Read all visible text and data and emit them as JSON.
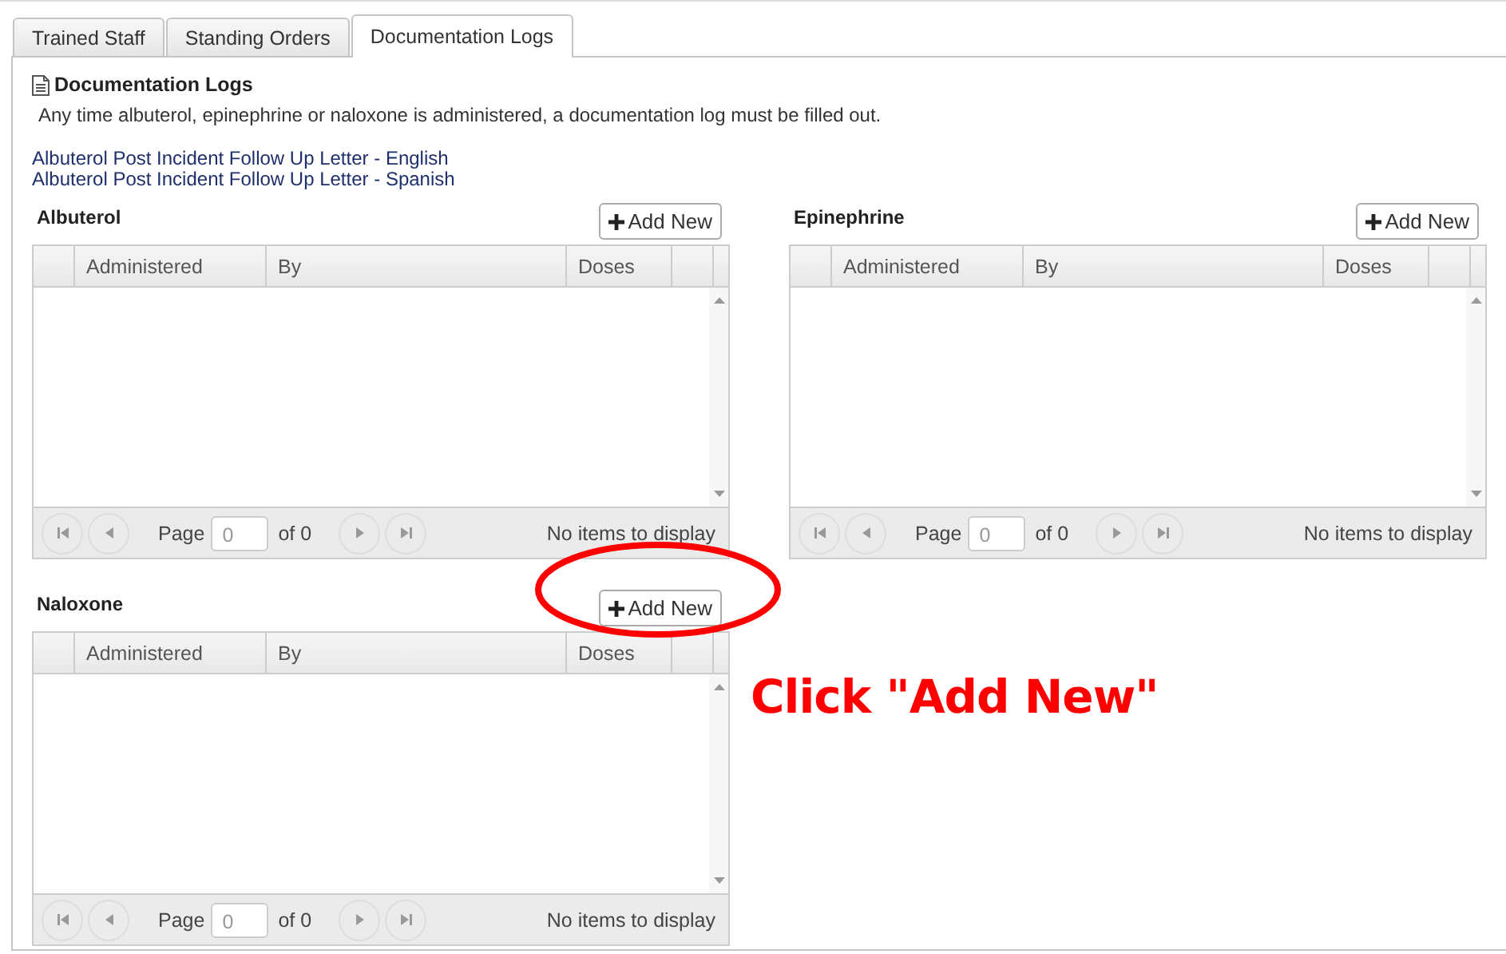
{
  "tabs": [
    {
      "label": "Trained Staff",
      "selected": false
    },
    {
      "label": "Standing Orders",
      "selected": false
    },
    {
      "label": "Documentation Logs",
      "selected": true
    }
  ],
  "header": {
    "title": "Documentation Logs",
    "description": "Any time albuterol, epinephrine or naloxone is administered, a documentation log must be filled out."
  },
  "links": [
    "Albuterol Post Incident Follow Up Letter - English",
    "Albuterol Post Incident Follow Up Letter - Spanish"
  ],
  "logs": [
    {
      "title": "Albuterol",
      "add_button": "Add New",
      "columns": [
        "Administered",
        "By",
        "Doses"
      ],
      "pager": {
        "page_label": "Page",
        "page_value": "0",
        "of_label": "of 0",
        "status": "No items to display"
      }
    },
    {
      "title": "Epinephrine",
      "add_button": "Add New",
      "columns": [
        "Administered",
        "By",
        "Doses"
      ],
      "pager": {
        "page_label": "Page",
        "page_value": "0",
        "of_label": "of 0",
        "status": "No items to display"
      }
    },
    {
      "title": "Naloxone",
      "add_button": "Add New",
      "columns": [
        "Administered",
        "By",
        "Doses"
      ],
      "pager": {
        "page_label": "Page",
        "page_value": "0",
        "of_label": "of 0",
        "status": "No items to display"
      }
    }
  ],
  "annotation": {
    "text": "Click \"Add New\""
  }
}
